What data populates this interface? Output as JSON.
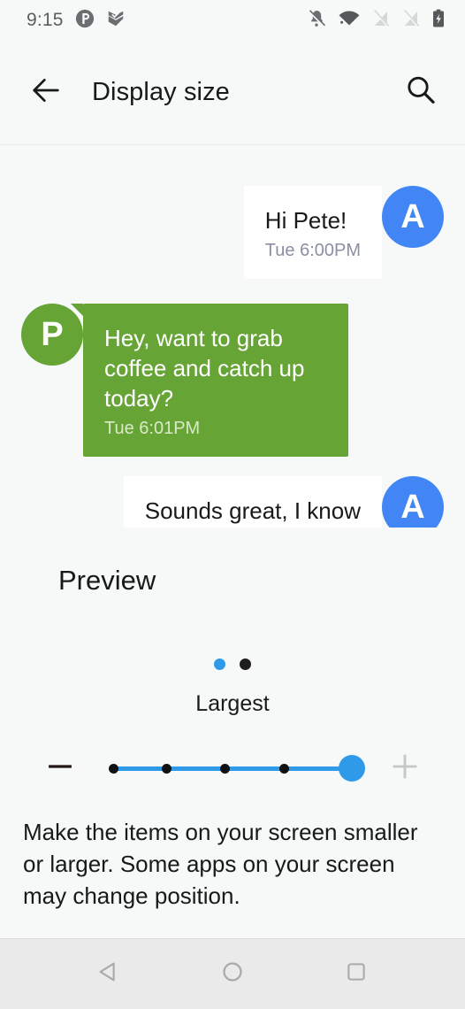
{
  "status_bar": {
    "time": "9:15",
    "notification_icons": [
      "pocketcasts-p-icon",
      "check-flag-icon"
    ],
    "system_icons": [
      "notifications-off-icon",
      "wifi-icon",
      "signal-empty-icon",
      "signal-empty-icon",
      "battery-charging-icon"
    ]
  },
  "app_bar": {
    "back_icon": "arrow-left-icon",
    "title": "Display size",
    "search_icon": "search-icon"
  },
  "preview": {
    "heading": "Preview",
    "messages": [
      {
        "align": "right",
        "avatar": "A",
        "avatar_color": "#4285F4",
        "bubble_color": "#FFFFFF",
        "text": "Hi Pete!",
        "time": "Tue 6:00PM"
      },
      {
        "align": "left",
        "avatar": "P",
        "avatar_color": "#67A436",
        "bubble_color": "#67A436",
        "text": "Hey, want to grab coffee and catch up today?",
        "time": "Tue 6:01PM"
      },
      {
        "align": "right",
        "avatar": "A",
        "avatar_color": "#4285F4",
        "bubble_color": "#FFFFFF",
        "text": "Sounds great, I know",
        "time": ""
      }
    ],
    "page_dots": [
      {
        "state": "active",
        "color": "#2F9BE8"
      },
      {
        "state": "inactive",
        "color": "#1D1D1D"
      }
    ]
  },
  "slider": {
    "current_label": "Largest",
    "value": 5,
    "min": 1,
    "max": 5,
    "decrease_icon": "minus-icon",
    "decrease_enabled": true,
    "increase_icon": "plus-icon",
    "increase_enabled": false,
    "accent_color": "#2F9BE8",
    "tick_color": "#111111"
  },
  "description": "Make the items on your screen smaller or larger. Some apps on your screen may change position.",
  "nav_bar": {
    "back_icon": "nav-back-triangle-icon",
    "home_icon": "nav-home-circle-icon",
    "recents_icon": "nav-recents-square-icon"
  }
}
